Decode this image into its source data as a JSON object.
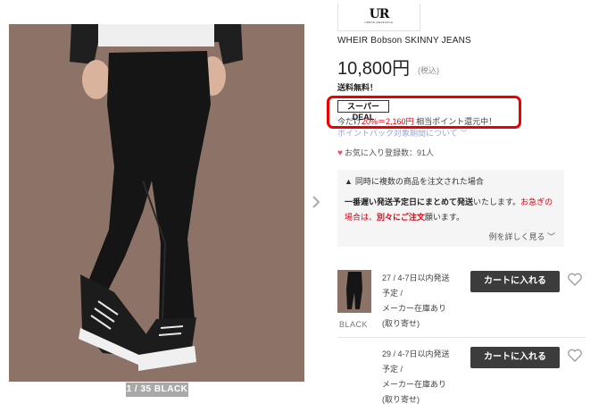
{
  "gallery": {
    "caption": "1 / 35  BLACK",
    "next_icon": "chevron-right-icon"
  },
  "brand": {
    "logo_mark": "UR",
    "logo_sub": "URBAN RESEARCH"
  },
  "product": {
    "name": "WHEIR Bobson SKINNY JEANS",
    "price": "10,800円",
    "tax_note": "(税込)",
    "shipping": "送料無料！"
  },
  "deal": {
    "badge": "スーパーDEAL",
    "text_prefix": "今だけ",
    "text_highlight": "20%＝2,160円",
    "text_suffix": " 相当ポイント還元中！",
    "highlight_color": "#ee0000"
  },
  "pointback": {
    "label": "ポイントバック対象期間について"
  },
  "favorites": {
    "label": "お気に入り登録数：91人"
  },
  "notice": {
    "title": "同時に複数の商品を注文された場合",
    "bold1": "一番遅い発送予定日にまとめて発送",
    "text1": "いたします。",
    "red1": "お急ぎの場合は、",
    "red2": "別々にご注文",
    "text2": "願います。",
    "link": "例を詳しく見る"
  },
  "skus": [
    {
      "color_label": "BLACK",
      "size": "27",
      "line1": "27 / 4-7日以内発送",
      "line2": "予定 /",
      "line3": "メーカー在庫あり",
      "line4": "(取り寄せ)",
      "cart_label": "カートに入れる"
    },
    {
      "size": "29",
      "line1": "29 / 4-7日以内発送",
      "line2": "予定 /",
      "line3": "メーカー在庫あり",
      "line4": "(取り寄せ)",
      "cart_label": "カートに入れる"
    }
  ],
  "colors": {
    "accent_red": "#e60012",
    "cart_button": "#3c3c3c",
    "photo_background": "#8d7367"
  }
}
